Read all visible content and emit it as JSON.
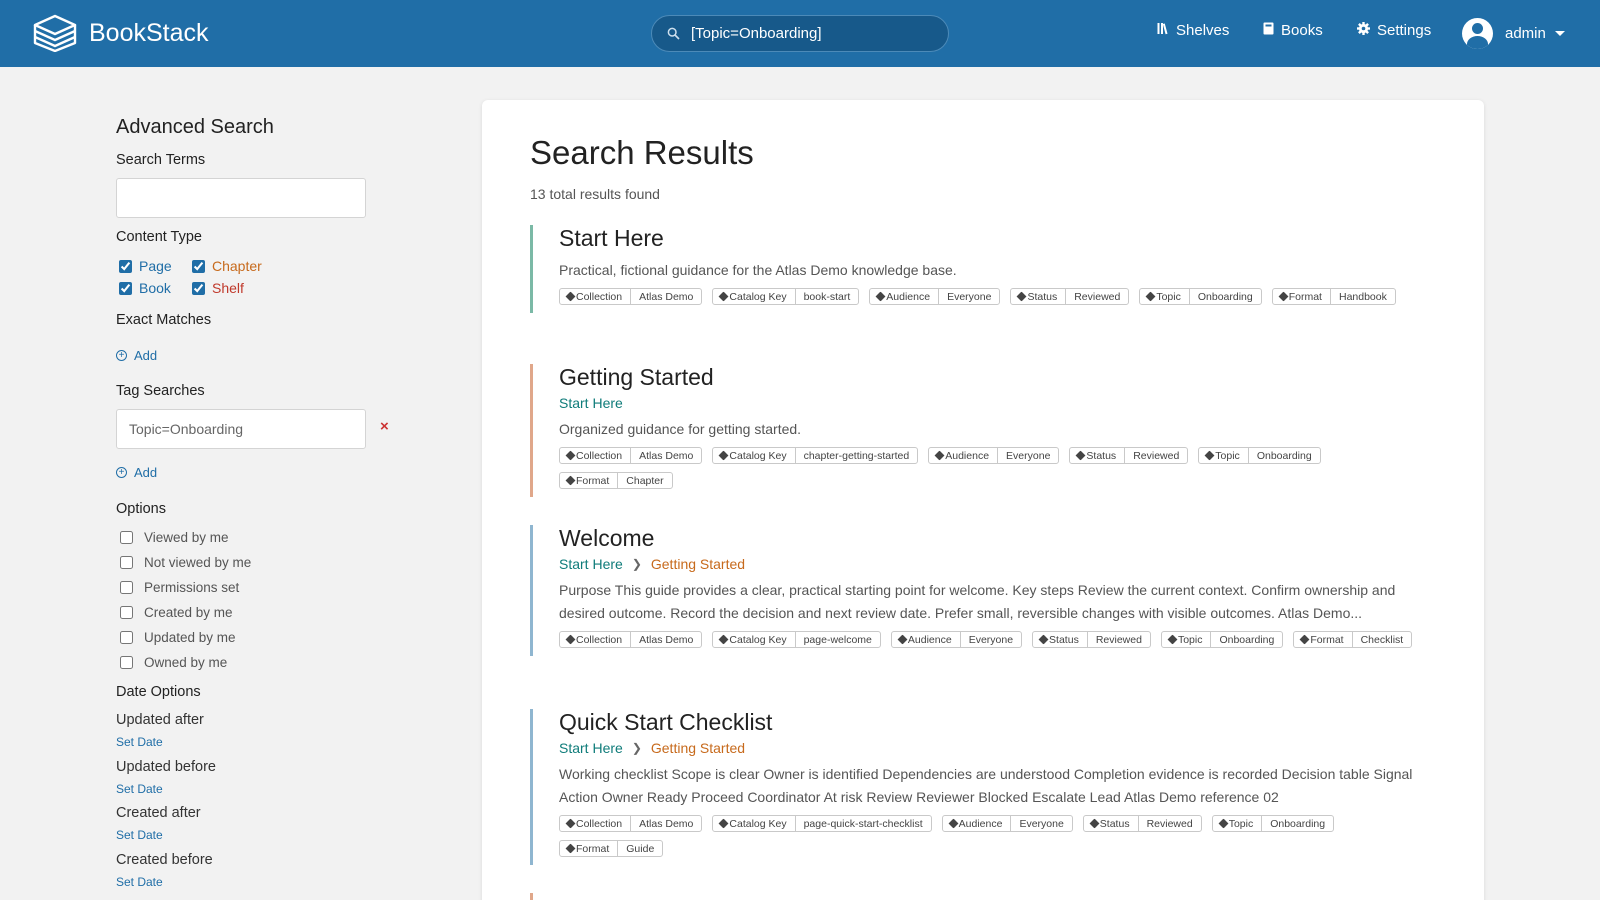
{
  "header": {
    "app_name": "BookStack",
    "search_value": "[Topic=Onboarding]",
    "nav": {
      "shelves": "Shelves",
      "books": "Books",
      "settings": "Settings"
    },
    "user": "admin"
  },
  "sidebar": {
    "title": "Advanced Search",
    "search_terms_label": "Search Terms",
    "search_terms_value": "",
    "content_type_label": "Content Type",
    "content_types": {
      "page": "Page",
      "chapter": "Chapter",
      "book": "Book",
      "shelf": "Shelf"
    },
    "exact_matches_label": "Exact Matches",
    "add_label": "Add",
    "tag_searches_label": "Tag Searches",
    "tag_search_value": "Topic=Onboarding",
    "remove_symbol": "×",
    "options_label": "Options",
    "options": [
      "Viewed by me",
      "Not viewed by me",
      "Permissions set",
      "Created by me",
      "Updated by me",
      "Owned by me"
    ],
    "date_options_label": "Date Options",
    "dates": [
      "Updated after",
      "Updated before",
      "Created after",
      "Created before"
    ],
    "set_date_label": "Set Date"
  },
  "main": {
    "title": "Search Results",
    "count": "13 total results found",
    "results": [
      {
        "title": "Start Here",
        "description": "Practical, fictional guidance for the Atlas Demo knowledge base.",
        "tags": [
          {
            "name": "Collection",
            "value": "Atlas Demo"
          },
          {
            "name": "Catalog Key",
            "value": "book-start"
          },
          {
            "name": "Audience",
            "value": "Everyone"
          },
          {
            "name": "Status",
            "value": "Reviewed"
          },
          {
            "name": "Topic",
            "value": "Onboarding"
          },
          {
            "name": "Format",
            "value": "Handbook"
          }
        ]
      },
      {
        "title": "Getting Started",
        "breadcrumb_book": "Start Here",
        "description": "Organized guidance for getting started.",
        "tags": [
          {
            "name": "Collection",
            "value": "Atlas Demo"
          },
          {
            "name": "Catalog Key",
            "value": "chapter-getting-started"
          },
          {
            "name": "Audience",
            "value": "Everyone"
          },
          {
            "name": "Status",
            "value": "Reviewed"
          },
          {
            "name": "Topic",
            "value": "Onboarding"
          },
          {
            "name": "Format",
            "value": "Chapter"
          }
        ]
      },
      {
        "title": "Welcome",
        "breadcrumb_book": "Start Here",
        "breadcrumb_chapter": "Getting Started",
        "description": "Purpose This guide provides a clear, practical starting point for welcome. Key steps Review the current context. Confirm ownership and desired outcome. Record the decision and next review date. Prefer small, reversible changes with visible outcomes. Atlas Demo...",
        "tags": [
          {
            "name": "Collection",
            "value": "Atlas Demo"
          },
          {
            "name": "Catalog Key",
            "value": "page-welcome"
          },
          {
            "name": "Audience",
            "value": "Everyone"
          },
          {
            "name": "Status",
            "value": "Reviewed"
          },
          {
            "name": "Topic",
            "value": "Onboarding"
          },
          {
            "name": "Format",
            "value": "Checklist"
          }
        ]
      },
      {
        "title": "Quick Start Checklist",
        "breadcrumb_book": "Start Here",
        "breadcrumb_chapter": "Getting Started",
        "description": "Working checklist Scope is clear Owner is identified Dependencies are understood Completion evidence is recorded Decision table Signal Action Owner Ready Proceed Coordinator At risk Review Reviewer Blocked Escalate Lead Atlas Demo reference 02",
        "tags": [
          {
            "name": "Collection",
            "value": "Atlas Demo"
          },
          {
            "name": "Catalog Key",
            "value": "page-quick-start-checklist"
          },
          {
            "name": "Audience",
            "value": "Everyone"
          },
          {
            "name": "Status",
            "value": "Reviewed"
          },
          {
            "name": "Topic",
            "value": "Onboarding"
          },
          {
            "name": "Format",
            "value": "Guide"
          }
        ]
      }
    ]
  },
  "colors": {
    "header": "#206ea7",
    "book": "#7bb9a6",
    "chapter": "#e0a78a",
    "page": "#8fb6d0",
    "link": "#206ea7",
    "chapter_link": "#c76a1c"
  }
}
